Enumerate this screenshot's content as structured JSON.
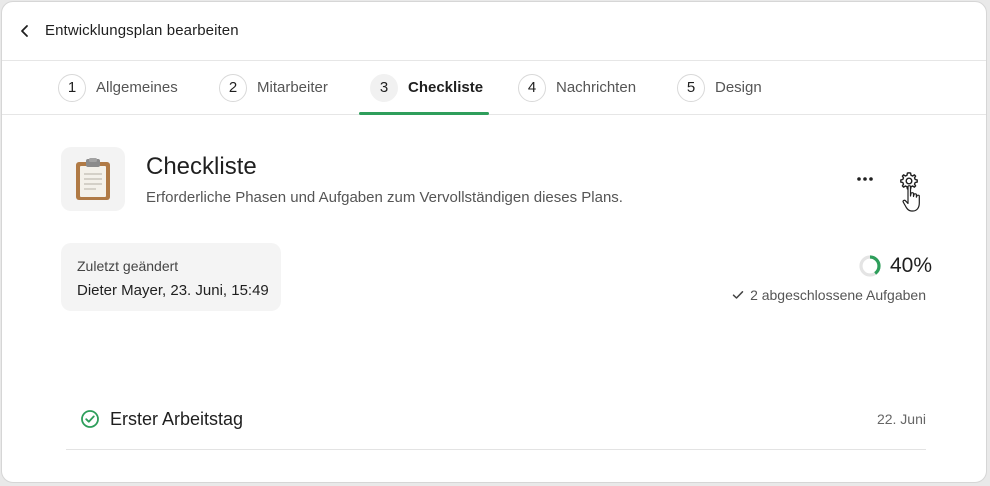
{
  "header": {
    "title": "Entwicklungsplan bearbeiten"
  },
  "tabs": [
    {
      "num": "1",
      "label": "Allgemeines",
      "active": false
    },
    {
      "num": "2",
      "label": "Mitarbeiter",
      "active": false
    },
    {
      "num": "3",
      "label": "Checkliste",
      "active": true
    },
    {
      "num": "4",
      "label": "Nachrichten",
      "active": false
    },
    {
      "num": "5",
      "label": "Design",
      "active": false
    }
  ],
  "section": {
    "icon": "clipboard-icon",
    "title": "Checkliste",
    "subtitle": "Erforderliche Phasen und Aufgaben zum Vervollständigen dieses Plans."
  },
  "last_changed": {
    "label": "Zuletzt geändert",
    "value": "Dieter Mayer, 23. Juni, 15:49"
  },
  "progress": {
    "fraction": 0.4,
    "percent_label": "40%",
    "completed_label": "2 abgeschlossene Aufgaben"
  },
  "phases": [
    {
      "title": "Erster Arbeitstag",
      "date": "22. Juni",
      "completed": true
    }
  ],
  "colors": {
    "accent": "#2e9e5b",
    "progress_track": "#e4e4e4"
  }
}
